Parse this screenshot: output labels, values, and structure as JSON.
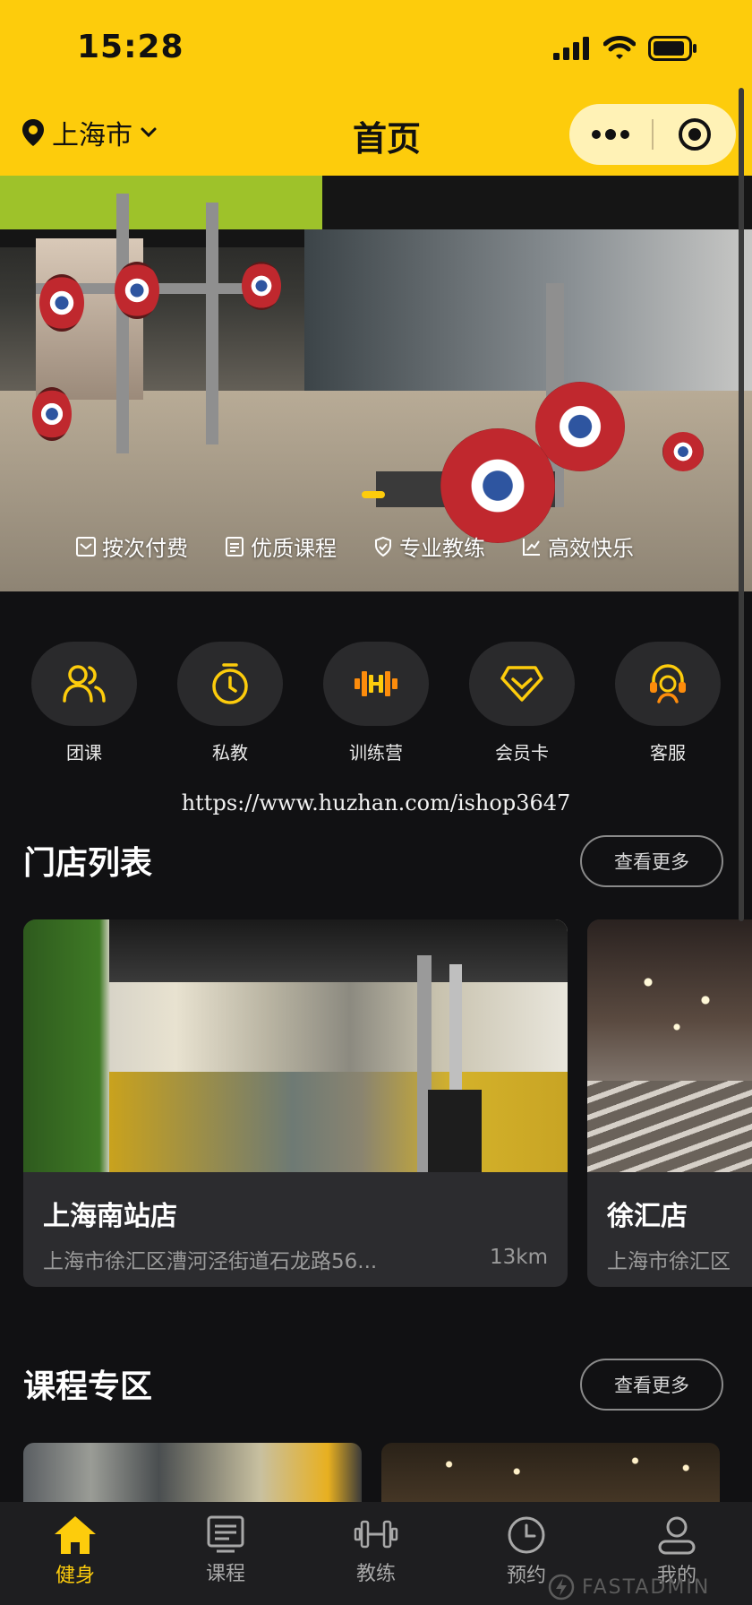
{
  "status_bar": {
    "time": "15:28"
  },
  "header": {
    "city": "上海市",
    "title": "首页"
  },
  "banner": {
    "tags": [
      "按次付费",
      "优质课程",
      "专业教练",
      "高效快乐"
    ]
  },
  "quick_menu": [
    {
      "label": "团课",
      "icon": "group-class-icon"
    },
    {
      "label": "私教",
      "icon": "stopwatch-icon"
    },
    {
      "label": "训练营",
      "icon": "dumbbell-icon"
    },
    {
      "label": "会员卡",
      "icon": "diamond-card-icon"
    },
    {
      "label": "客服",
      "icon": "headset-icon"
    }
  ],
  "watermark_url": "https://www.huzhan.com/ishop3647",
  "stores_section": {
    "title": "门店列表",
    "more_label": "查看更多",
    "stores": [
      {
        "name": "上海南站店",
        "address": "上海市徐汇区漕河泾街道石龙路56...",
        "distance": "13km"
      },
      {
        "name": "徐汇店",
        "address": "上海市徐汇区"
      }
    ]
  },
  "courses_section": {
    "title": "课程专区",
    "more_label": "查看更多"
  },
  "tab_bar": {
    "items": [
      {
        "label": "健身",
        "icon": "home-icon",
        "active": true
      },
      {
        "label": "课程",
        "icon": "list-icon",
        "active": false
      },
      {
        "label": "教练",
        "icon": "dumbbell-icon",
        "active": false
      },
      {
        "label": "预约",
        "icon": "clock-icon",
        "active": false
      },
      {
        "label": "我的",
        "icon": "user-icon",
        "active": false
      }
    ]
  },
  "footer_watermark": "FASTADMIN",
  "colors": {
    "accent": "#fdcc0c",
    "background": "#111113",
    "card": "#2c2c2f"
  }
}
